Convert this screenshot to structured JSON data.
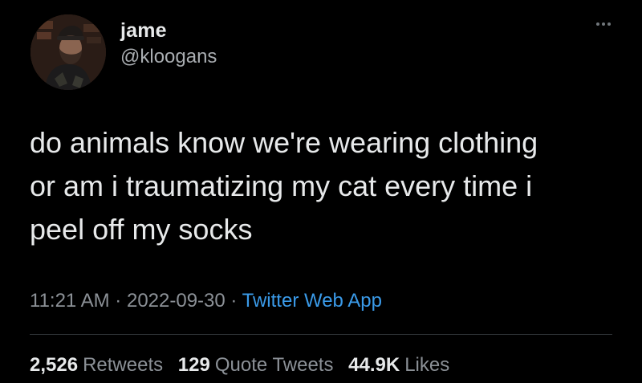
{
  "author": {
    "display_name": "jame",
    "handle": "@kloogans"
  },
  "tweet": {
    "text_lines": [
      "do animals know we're wearing clothing",
      "or am i traumatizing my cat every time i",
      "peel off my socks"
    ],
    "time": "11:21 AM",
    "separator": "·",
    "date": "2022-09-30",
    "source": "Twitter Web App"
  },
  "stats": {
    "retweets_count": "2,526",
    "retweets_label": "Retweets",
    "quotes_count": "129",
    "quotes_label": "Quote Tweets",
    "likes_count": "44.9K",
    "likes_label": "Likes"
  },
  "icons": {
    "more": "more-horizontal-icon",
    "avatar": "user-avatar"
  },
  "colors": {
    "background": "#000000",
    "primary_text": "#e7e9ea",
    "secondary_text": "#8b9096",
    "link": "#3a9ae8"
  }
}
